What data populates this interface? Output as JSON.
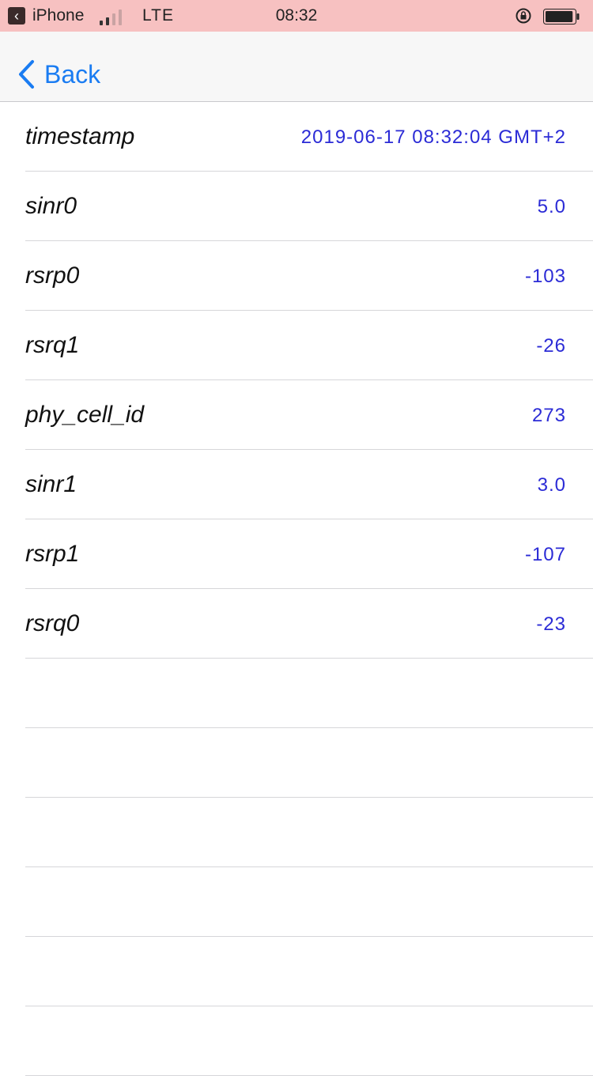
{
  "status_bar": {
    "carrier": "iPhone",
    "network": "LTE",
    "time": "08:32",
    "signal_bars_active": 2,
    "signal_bars_total": 4,
    "battery_level": 0.95,
    "background_color": "#f7c1c1"
  },
  "nav": {
    "back_label": "Back",
    "accent_color": "#1a7cf2"
  },
  "rows": [
    {
      "key": "timestamp",
      "value": "2019-06-17 08:32:04 GMT+2"
    },
    {
      "key": "sinr0",
      "value": "5.0"
    },
    {
      "key": "rsrp0",
      "value": "-103"
    },
    {
      "key": "rsrq1",
      "value": "-26"
    },
    {
      "key": "phy_cell_id",
      "value": "273"
    },
    {
      "key": "sinr1",
      "value": "3.0"
    },
    {
      "key": "rsrp1",
      "value": "-107"
    },
    {
      "key": "rsrq0",
      "value": "-23"
    },
    {
      "key": "",
      "value": ""
    },
    {
      "key": "",
      "value": ""
    },
    {
      "key": "",
      "value": ""
    },
    {
      "key": "",
      "value": ""
    },
    {
      "key": "",
      "value": ""
    },
    {
      "key": "",
      "value": ""
    }
  ]
}
